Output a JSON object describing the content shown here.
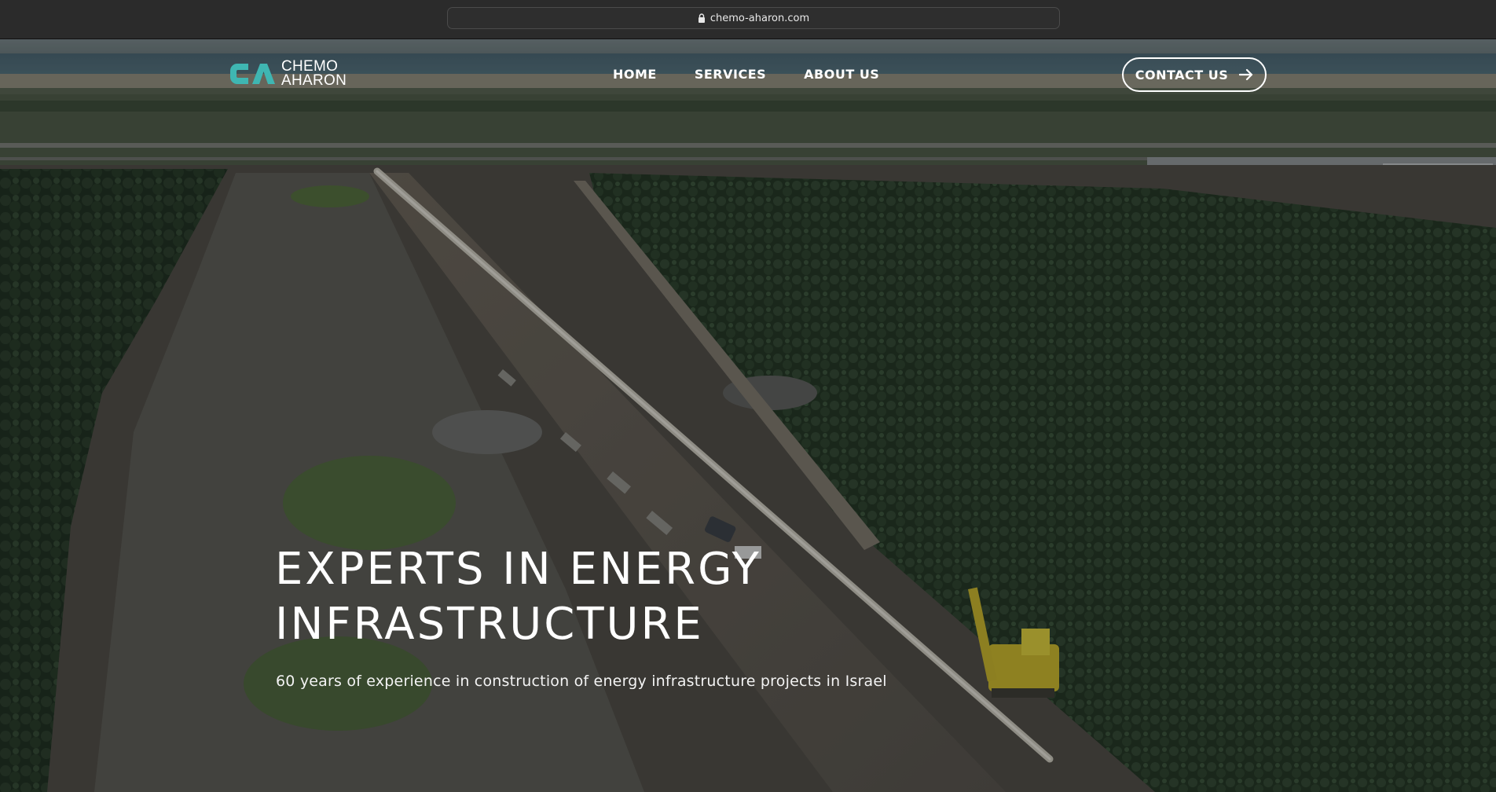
{
  "browser": {
    "url": "chemo-aharon.com",
    "lock_icon": "lock-icon"
  },
  "header": {
    "logo": {
      "line1": "CHEMO",
      "line2": "AHARON",
      "mark_color": "#3fb6b2"
    },
    "nav": [
      {
        "label": "HOME"
      },
      {
        "label": "SERVICES"
      },
      {
        "label": "ABOUT US"
      }
    ],
    "contact_button": {
      "label": "CONTACT US",
      "icon": "arrow-right-icon"
    }
  },
  "hero": {
    "title": "EXPERTS IN ENERGY\nINFRASTRUCTURE",
    "subtitle": "60 years of experience in construction of energy infrastructure projects in Israel",
    "background": "aerial-pipeline-photo"
  }
}
